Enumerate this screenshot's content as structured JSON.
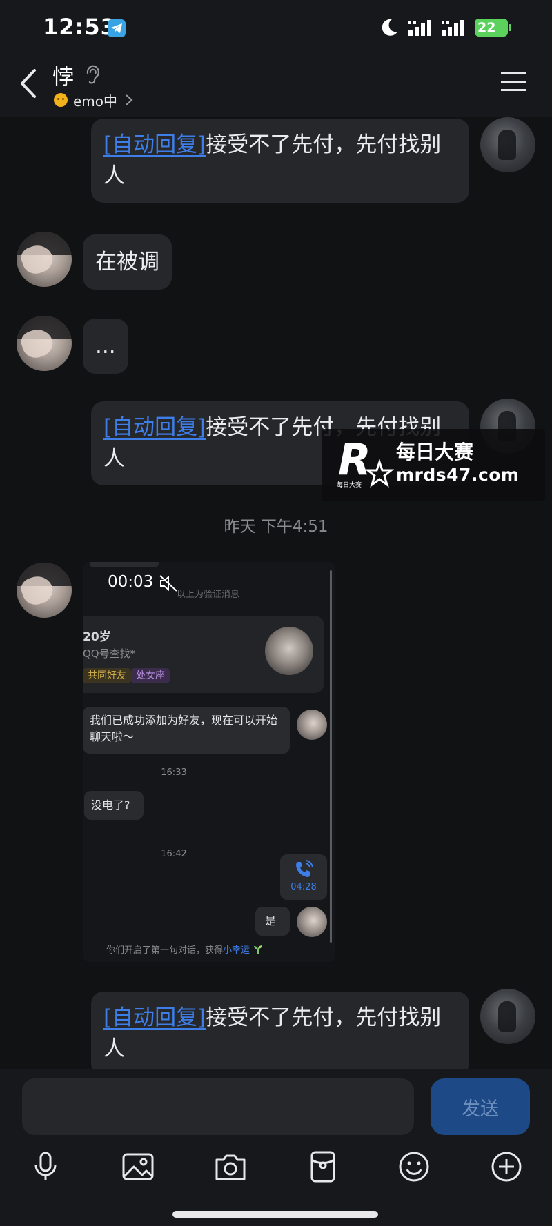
{
  "status_bar": {
    "time": "12:53",
    "battery": "22"
  },
  "header": {
    "contact_name": "悖",
    "status": "emo中"
  },
  "auto_reply": {
    "tag": "[自动回复]",
    "text": "接受不了先付，先付找别人"
  },
  "messages": [
    {
      "from": "self",
      "type": "auto_reply"
    },
    {
      "from": "peer",
      "text": "在被调"
    },
    {
      "from": "peer",
      "text": "..."
    },
    {
      "from": "self",
      "type": "auto_reply"
    },
    {
      "from": "system",
      "text": "昨天 下午4:51"
    },
    {
      "from": "peer",
      "type": "image"
    },
    {
      "from": "self",
      "type": "auto_reply"
    }
  ],
  "timestamp": "昨天 下午4:51",
  "peer_msgs": {
    "m1": "在被调",
    "m2": "..."
  },
  "shared_screenshot": {
    "video_time": "00:03",
    "verify_hint": "以上为验证消息",
    "profile": {
      "age": "20岁",
      "source": "QQ号查找*",
      "tags": [
        "共同好友",
        "处女座"
      ]
    },
    "friend_added": "我们已成功添加为好友，现在可以开始聊天啦～",
    "time_1": "16:33",
    "no_power": "没电了?",
    "time_2": "16:42",
    "call_duration": "04:28",
    "reply_yes": "是",
    "footer_prefix": "你们开启了第一句对话，获得",
    "footer_link": "小幸运"
  },
  "watermark": {
    "logo_letter": "R",
    "logo_small": "每日大赛",
    "title": "每日大赛",
    "url": "mrds47.com"
  },
  "input_bar": {
    "placeholder": "",
    "send_label": "发送"
  },
  "colors": {
    "background": "#111214",
    "bubble": "#26272b",
    "auto_reply_tag": "#3d7ee8",
    "send_button": "#1d4a86"
  }
}
